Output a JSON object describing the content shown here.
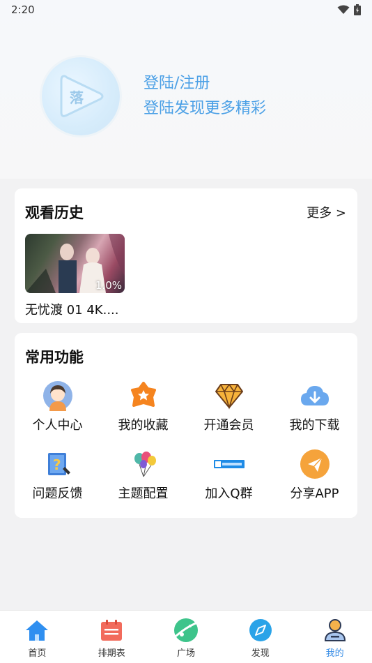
{
  "status_bar": {
    "time": "2:20"
  },
  "profile": {
    "login_text": "登陆/注册",
    "subtitle": "登陆发现更多精彩"
  },
  "history": {
    "title": "观看历史",
    "more": "更多 >",
    "items": [
      {
        "title": "无忧渡 01 4K....",
        "progress": "1.0%"
      }
    ]
  },
  "functions": {
    "title": "常用功能",
    "items": [
      {
        "label": "个人中心",
        "icon": "user-center-icon"
      },
      {
        "label": "我的收藏",
        "icon": "favorite-star-icon"
      },
      {
        "label": "开通会员",
        "icon": "vip-diamond-icon"
      },
      {
        "label": "我的下载",
        "icon": "cloud-download-icon"
      },
      {
        "label": "问题反馈",
        "icon": "feedback-icon"
      },
      {
        "label": "主题配置",
        "icon": "balloons-icon"
      },
      {
        "label": "加入Q群",
        "icon": "qq-group-icon"
      },
      {
        "label": "分享APP",
        "icon": "share-icon"
      }
    ]
  },
  "tabbar": {
    "items": [
      {
        "label": "首页",
        "icon": "home-icon"
      },
      {
        "label": "排期表",
        "icon": "calendar-icon"
      },
      {
        "label": "广场",
        "icon": "planet-icon"
      },
      {
        "label": "发现",
        "icon": "compass-icon"
      },
      {
        "label": "我的",
        "icon": "profile-icon",
        "active": true
      }
    ]
  },
  "colors": {
    "accent": "#3a8ee6",
    "login_text": "#4ba0e6"
  }
}
